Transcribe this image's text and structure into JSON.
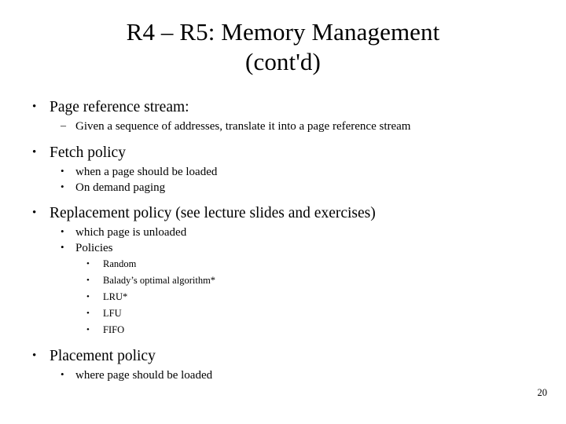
{
  "slide": {
    "title_lines": [
      "R4 – R5: Memory Management",
      "(cont'd)"
    ],
    "page_number": "20",
    "background_color": "#ffffff",
    "text_color": "#000000",
    "outline": [
      {
        "level": 1,
        "marker": "•",
        "text": "Page reference stream:"
      },
      {
        "level": 2,
        "marker": "–",
        "text": "Given a sequence of addresses, translate it into a page reference stream"
      },
      {
        "level": 1,
        "marker": "•",
        "text": "Fetch policy"
      },
      {
        "level": 2,
        "marker": "•",
        "text": "when a page should be loaded"
      },
      {
        "level": 2,
        "marker": "•",
        "text": "On demand paging"
      },
      {
        "level": 1,
        "marker": "•",
        "text": "Replacement policy (see lecture slides and exercises)"
      },
      {
        "level": 2,
        "marker": "•",
        "text": "which page is unloaded"
      },
      {
        "level": 2,
        "marker": "•",
        "text": "Policies"
      },
      {
        "level": 3,
        "marker": "•",
        "text": "Random"
      },
      {
        "level": 3,
        "marker": "•",
        "text": "Balady’s optimal algorithm*"
      },
      {
        "level": 3,
        "marker": "•",
        "text": "LRU*"
      },
      {
        "level": 3,
        "marker": "•",
        "text": "LFU"
      },
      {
        "level": 3,
        "marker": "•",
        "text": "FIFO"
      },
      {
        "level": 1,
        "marker": "•",
        "text": "Placement policy"
      },
      {
        "level": 2,
        "marker": "•",
        "text": "where page should be loaded"
      }
    ]
  }
}
